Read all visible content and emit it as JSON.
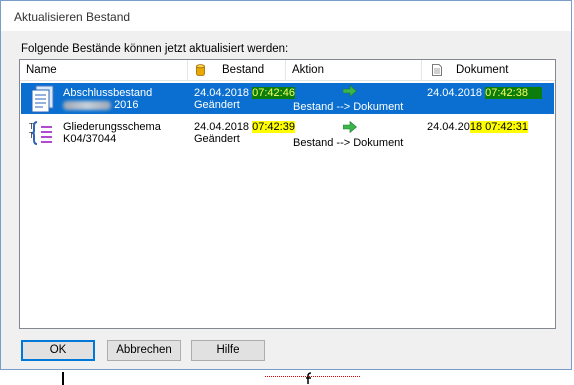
{
  "window": {
    "title": "Aktualisieren Bestand"
  },
  "instruction": "Folgende Bestände können jetzt aktualisiert werden:",
  "columns": {
    "name": "Name",
    "bestand": "Bestand",
    "aktion": "Aktion",
    "dokument": "Dokument"
  },
  "rows": [
    {
      "name_line1": "Abschlussbestand",
      "name_line2": "2016",
      "bestand_date": "24.04.2018 ",
      "bestand_time": "07:42:46",
      "bestand_status": "Geändert",
      "aktion": "Bestand --> Dokument",
      "dokument_date": "24.04.2018 ",
      "dokument_time": "07:42:38",
      "icon": "document-list-icon"
    },
    {
      "name_line1": "Gliederungsschema",
      "name_line2": "K04/37044",
      "bestand_date": "24.04.2018 ",
      "bestand_time": "07:42:39",
      "bestand_status": "Geändert",
      "aktion": "Bestand --> Dokument",
      "dokument_date_prefix": "24.04.20",
      "dokument_date_suffix": "18 ",
      "dokument_time": "07:42:31",
      "icon": "outline-schema-icon"
    }
  ],
  "buttons": {
    "ok": "OK",
    "cancel": "Abbrechen",
    "help": "Hilfe"
  },
  "colors": {
    "selection": "#0a6fd0",
    "highlight": "#ffff00",
    "arrow": "#39b54a"
  }
}
